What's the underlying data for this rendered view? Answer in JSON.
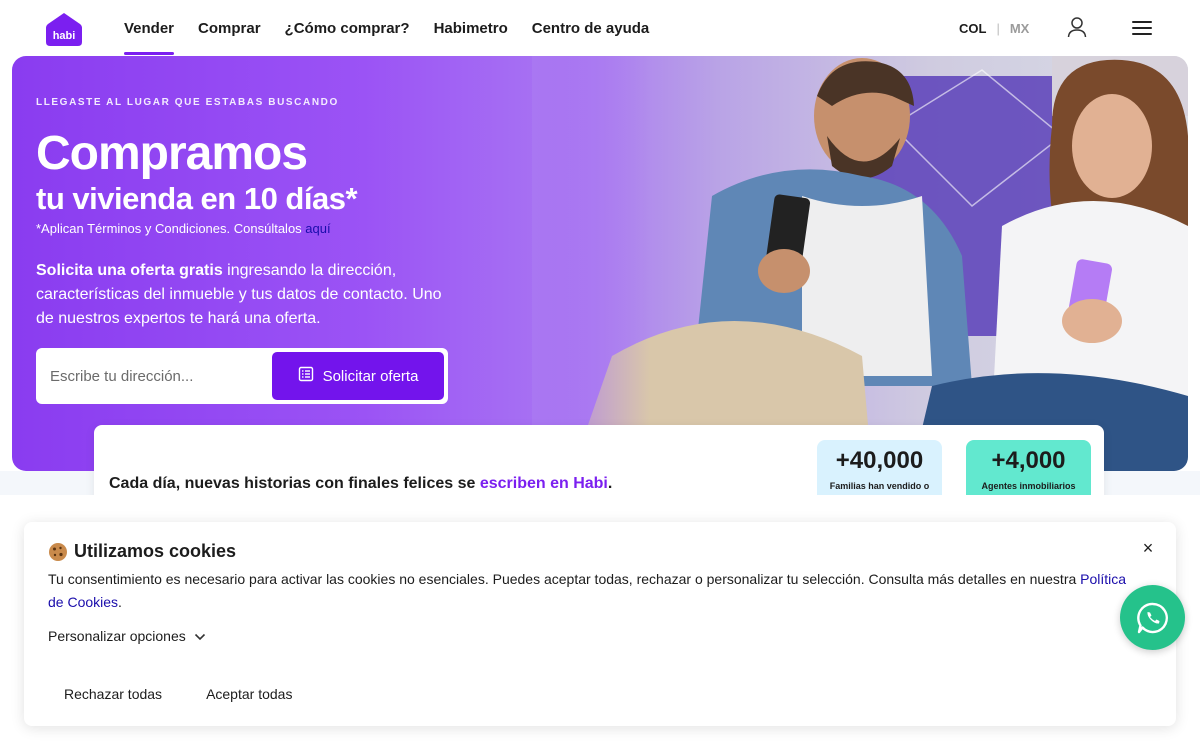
{
  "header": {
    "logo_text": "habi",
    "nav": [
      {
        "label": "Vender",
        "active": true
      },
      {
        "label": "Comprar",
        "active": false
      },
      {
        "label": "¿Cómo comprar?",
        "active": false
      },
      {
        "label": "Habimetro",
        "active": false
      },
      {
        "label": "Centro de ayuda",
        "active": false
      }
    ],
    "country_selected": "COL",
    "country_other": "MX",
    "user_icon": "user-icon",
    "menu_icon": "hamburger-menu-icon"
  },
  "hero": {
    "eyebrow": "LLEGASTE AL LUGAR QUE ESTABAS BUSCANDO",
    "title": "Compramos",
    "subtitle": "tu vivienda en 10 días*",
    "terms_text": "*Aplican Términos y Condiciones. Consúltalos ",
    "terms_link": "aquí",
    "desc_bold": "Solicita una oferta gratis",
    "desc_rest": " ingresando la dirección, características del inmueble y tus datos de contacto. Uno de nuestros expertos te hará una oferta.",
    "search_placeholder": "Escribe tu dirección...",
    "offer_button": "Solicitar oferta",
    "offer_icon": "form-list-icon"
  },
  "stats": {
    "text_before": "Cada día, nuevas historias con finales felices se ",
    "text_highlight": "escriben en Habi",
    "text_after": ".",
    "items": [
      {
        "value": "+40,000",
        "label": "Familias han vendido o"
      },
      {
        "value": "+4,000",
        "label": "Agentes inmobiliarios"
      }
    ]
  },
  "cookies": {
    "title": "Utilizamos cookies",
    "icon": "cookie-icon",
    "body": "Tu consentimiento es necesario para activar las cookies no esenciales. Puedes aceptar todas, rechazar o personalizar tu selección. Consulta más detalles en nuestra ",
    "policy_link": "Política de Cookies",
    "body_end": ".",
    "personalize": "Personalizar opciones",
    "reject": "Rechazar todas",
    "accept": "Aceptar todas",
    "close": "×"
  },
  "whatsapp_icon": "whatsapp-icon",
  "colors": {
    "brand_purple": "#7314ec",
    "stat1_bg": "#d9f2fe",
    "stat2_bg": "#62e8cf",
    "whatsapp": "#25c28b"
  }
}
